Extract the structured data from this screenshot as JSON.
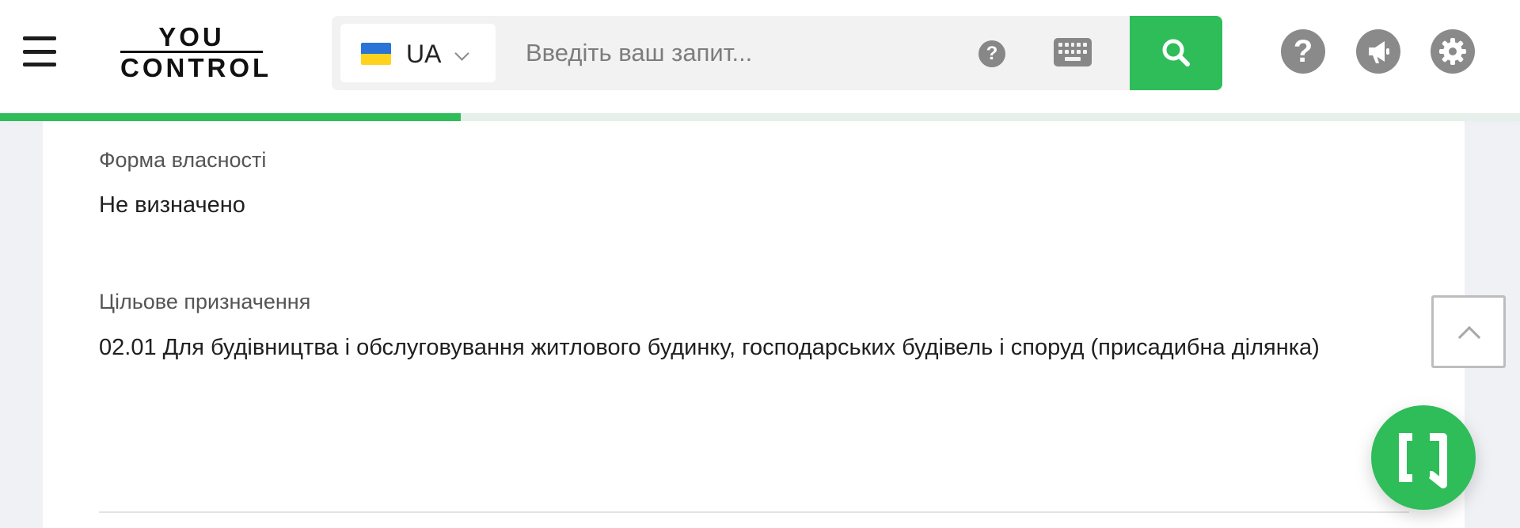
{
  "header": {
    "logo_line1": "YOU",
    "logo_line2": "CONTROL",
    "language": {
      "code": "UA",
      "flag_colors": [
        "#2a74d6",
        "#ffd21f"
      ]
    },
    "search": {
      "placeholder": "Введіть ваш запит...",
      "value": ""
    },
    "help_small_glyph": "?",
    "help_glyph": "?",
    "icons": [
      "menu-icon",
      "chevron-down-icon",
      "question-icon",
      "keyboard-icon",
      "search-icon",
      "question-icon",
      "megaphone-icon",
      "gear-icon",
      "chevron-up-icon",
      "chat-icon"
    ]
  },
  "loading_progress_fraction": 0.303,
  "fields": [
    {
      "label": "Форма власності",
      "value": "Не визначено"
    },
    {
      "label": "Цільове призначення",
      "value": "02.01 Для будівництва і обслуговування житлового будинку, господарських будівель і споруд (присадибна ділянка)"
    }
  ],
  "colors": {
    "accent": "#2ebd59",
    "icon_gray": "#8a8a8a",
    "page_bg": "#f0f1f5"
  }
}
